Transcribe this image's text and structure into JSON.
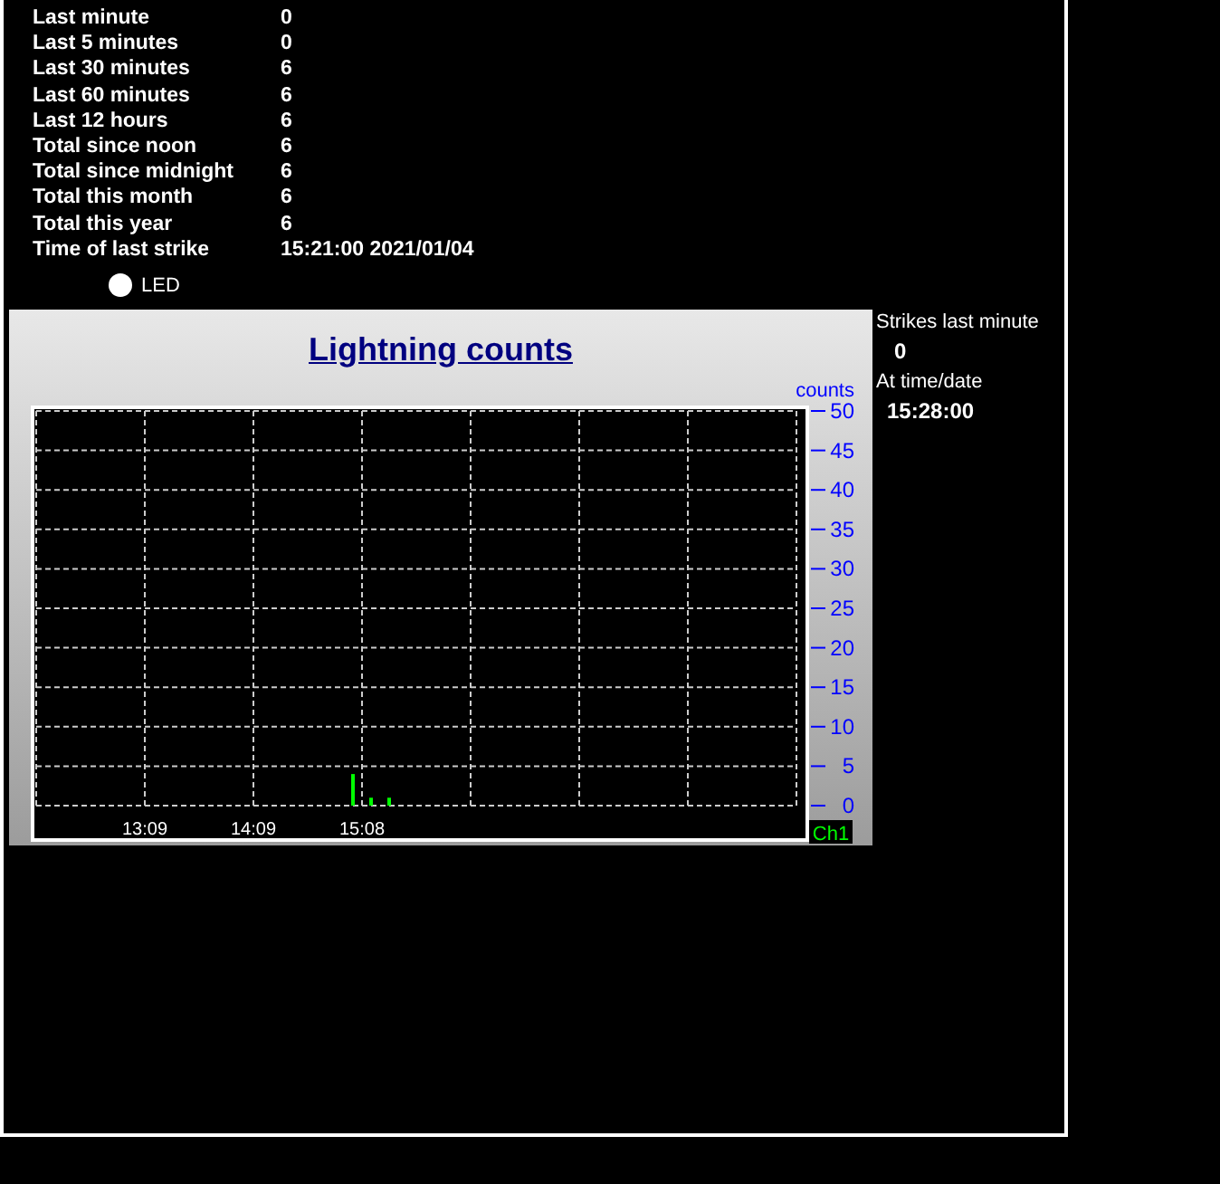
{
  "stats": [
    {
      "label": "Last minute",
      "value": "0"
    },
    {
      "label": "Last 5 minutes",
      "value": "0"
    },
    {
      "label": "Last 30 minutes",
      "value": "6"
    },
    {
      "label": "Last 60 minutes",
      "value": "6"
    },
    {
      "label": "Last 12 hours",
      "value": "6"
    },
    {
      "label": "Total since noon",
      "value": "6"
    },
    {
      "label": "Total since midnight",
      "value": "6"
    },
    {
      "label": "Total this month",
      "value": "6"
    },
    {
      "label": "Total this year",
      "value": "6"
    },
    {
      "label": "Time of last strike",
      "value": "15:21:00 2021/01/04"
    }
  ],
  "led": {
    "label": "LED",
    "lit": false
  },
  "chart": {
    "title": "Lightning counts",
    "chart_data": {
      "type": "bar",
      "grid": true,
      "ylabel": "counts",
      "ylim": [
        0,
        50
      ],
      "yticks": [
        0,
        5,
        10,
        15,
        20,
        25,
        30,
        35,
        40,
        45,
        50
      ],
      "categories": [
        null,
        null,
        null,
        null,
        null,
        null,
        null,
        null,
        null,
        null,
        null,
        null,
        "13:09",
        null,
        null,
        null,
        null,
        null,
        null,
        null,
        null,
        null,
        null,
        null,
        "14:09",
        null,
        null,
        null,
        null,
        null,
        null,
        null,
        null,
        null,
        null,
        null,
        "15:08",
        null,
        null,
        null,
        null,
        null,
        null,
        null,
        null,
        null,
        null,
        null,
        null,
        null,
        null,
        null,
        null,
        null,
        null,
        null,
        null,
        null,
        null,
        null,
        null,
        null,
        null,
        null,
        null,
        null,
        null,
        null,
        null,
        null,
        null,
        null,
        null,
        null,
        null,
        null,
        null,
        null,
        null,
        null,
        null,
        null,
        null,
        null,
        null
      ],
      "series": [
        {
          "name": "Ch1",
          "color": "#00ff00",
          "values": [
            null,
            null,
            null,
            null,
            null,
            null,
            null,
            null,
            null,
            null,
            null,
            null,
            null,
            null,
            null,
            null,
            null,
            null,
            null,
            null,
            null,
            null,
            null,
            null,
            null,
            null,
            null,
            null,
            null,
            null,
            null,
            null,
            null,
            null,
            null,
            4,
            null,
            1,
            null,
            1,
            null,
            null,
            null,
            null,
            null,
            null,
            null,
            null,
            null,
            null,
            null,
            null,
            null,
            null,
            null,
            null,
            null,
            null,
            null,
            null,
            null,
            null,
            null,
            null,
            null,
            null,
            null,
            null,
            null,
            null,
            null,
            null,
            null,
            null,
            null,
            null,
            null,
            null,
            null,
            null,
            null,
            null,
            null,
            null,
            null
          ]
        }
      ]
    }
  },
  "side": {
    "strikes_label": "Strikes last minute",
    "strikes_value": "0",
    "time_label": "At time/date",
    "time_value": "15:28:00"
  }
}
